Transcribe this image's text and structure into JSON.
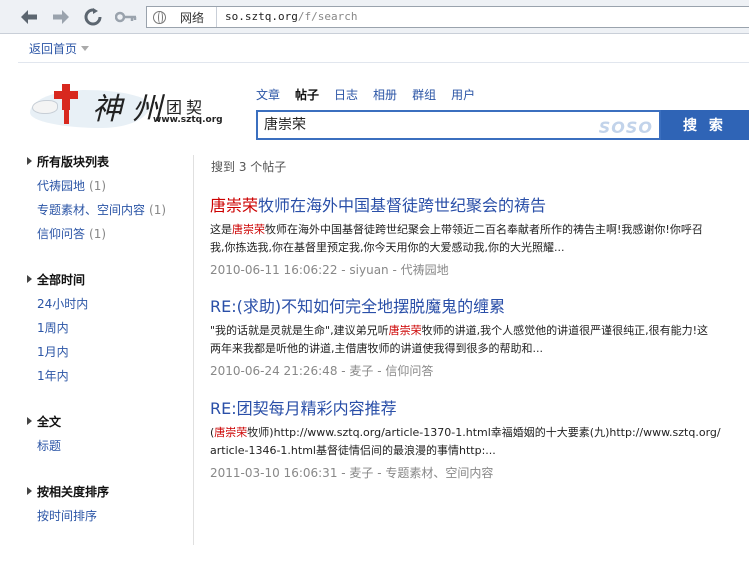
{
  "browser": {
    "site_label": "网络",
    "url_domain": "so.sztq.org",
    "url_path": "/f/search"
  },
  "header": {
    "back_home": "返回首页"
  },
  "logo": {
    "brush_text": "神州",
    "tuanqi_text": "团契",
    "url_text": "www.sztq.org"
  },
  "search": {
    "tabs": [
      "文章",
      "帖子",
      "日志",
      "相册",
      "群组",
      "用户"
    ],
    "active_tab": "帖子",
    "query": "唐崇荣",
    "soso_text": "SOSO",
    "button_label": "搜 索"
  },
  "sidebar": {
    "sections": [
      {
        "title": "所有版块列表",
        "items": [
          {
            "label": "代祷园地",
            "count": "(1)"
          },
          {
            "label": "专题素材、空间内容",
            "count": "(1)"
          },
          {
            "label": "信仰问答",
            "count": "(1)"
          }
        ]
      },
      {
        "title": "全部时间",
        "items": [
          {
            "label": "24小时内",
            "count": ""
          },
          {
            "label": "1周内",
            "count": ""
          },
          {
            "label": "1月内",
            "count": ""
          },
          {
            "label": "1年内",
            "count": ""
          }
        ]
      },
      {
        "title": "全文",
        "items": [
          {
            "label": "标题",
            "count": ""
          }
        ]
      },
      {
        "title": "按相关度排序",
        "items": [
          {
            "label": "按时间排序",
            "count": ""
          }
        ]
      }
    ]
  },
  "results": {
    "found_text": "搜到 3 个帖子",
    "items": [
      {
        "title_hl": "唐崇荣",
        "title_rest": "牧师在海外中国基督徒跨世纪聚会的祷告",
        "line1_pre": "这是",
        "line1_hl": "唐崇荣",
        "line1_post": "牧师在海外中国基督徒跨世纪聚会上带领近二百名奉献者所作的祷告主啊!我感谢你!你呼召",
        "line2_pre": "我,你拣选我,你在基督里预定我,你今天用你的大爱感动我,你的大光照耀...",
        "line2_hl": "",
        "line2_post": "",
        "meta": "2010-06-11 16:06:22 - siyuan - 代祷园地"
      },
      {
        "title_hl": "",
        "title_rest": "RE:(求助)不知如何完全地摆脱魔鬼的缠累",
        "line1_pre": "\"我的话就是灵就是生命\",建议弟兄听",
        "line1_hl": "唐崇荣",
        "line1_post": "牧师的讲道,我个人感觉他的讲道很严谨很纯正,很有能力!这",
        "line2_pre": "两年来我都是听他的讲道,主借唐牧师的讲道使我得到很多的帮助和...",
        "line2_hl": "",
        "line2_post": "",
        "meta": "2010-06-24 21:26:48 - 麦子 - 信仰问答"
      },
      {
        "title_hl": "",
        "title_rest": "RE:团契每月精彩内容推荐",
        "line1_pre": "(",
        "line1_hl": "唐崇荣",
        "line1_post": "牧师)http://www.sztq.org/article-1370-1.html幸福婚姻的十大要素(九)http://www.sztq.org/",
        "line2_pre": "article-1346-1.html基督徒情侣间的最浪漫的事情http:...",
        "line2_hl": "",
        "line2_post": "",
        "meta": "2011-03-10 16:06:31 - 麦子 - 专题素材、空间内容"
      }
    ]
  }
}
